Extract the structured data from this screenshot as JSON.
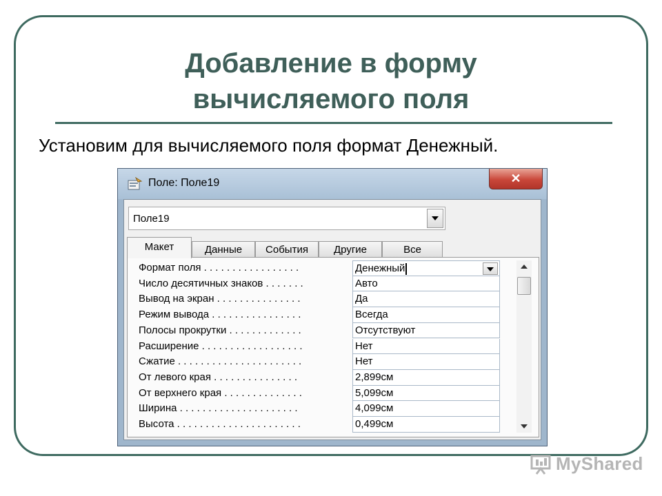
{
  "slide": {
    "title_line1": "Добавление в форму",
    "title_line2": "вычисляемого поля",
    "subtitle": "Установим для вычисляемого поля формат Денежный."
  },
  "dialog": {
    "title": "Поле: Поле19",
    "close_glyph": "✕",
    "object_combo": {
      "value": "Поле19"
    },
    "tabs": [
      {
        "label": "Макет",
        "active": true
      },
      {
        "label": "Данные",
        "active": false
      },
      {
        "label": "События",
        "active": false
      },
      {
        "label": "Другие",
        "active": false
      },
      {
        "label": "Все",
        "active": false
      }
    ],
    "properties": [
      {
        "label": "Формат поля . . . . . . . . . . . . . . . . .",
        "value": "Денежный"
      },
      {
        "label": "Число десятичных знаков . . . . . . .",
        "value": "Авто"
      },
      {
        "label": "Вывод на экран . . . . . . . . . . . . . . .",
        "value": "Да"
      },
      {
        "label": "Режим вывода . . . . . . . . . . . . . . . .",
        "value": "Всегда"
      },
      {
        "label": "Полосы прокрутки . . . . . . . . . . . . .",
        "value": "Отсутствуют"
      },
      {
        "label": "Расширение . . . . . . . . . . . . . . . . . .",
        "value": "Нет"
      },
      {
        "label": "Сжатие . . . . . . . . . . . . . . . . . . . . . .",
        "value": "Нет"
      },
      {
        "label": "От левого края . . . . . . . . . . . . . . .",
        "value": "2,899см"
      },
      {
        "label": "От верхнего края . . . . . . . . . . . . . .",
        "value": "5,099см"
      },
      {
        "label": "Ширина . . . . . . . . . . . . . . . . . . . . .",
        "value": "4,099см"
      },
      {
        "label": "Высота . . . . . . . . . . . . . . . . . . . . . .",
        "value": "0,499см"
      }
    ]
  },
  "watermark": {
    "text": "MyShared"
  },
  "icons": {
    "app": "form-properties-icon",
    "combo": "chevron-down-icon",
    "scroll_up": "arrow-up-icon",
    "scroll_down": "arrow-down-icon",
    "watermark": "presentation-board-icon"
  },
  "colors": {
    "title": "#3f5f59",
    "frame": "#3e6a60",
    "dialog_chrome": "#9fb6cc",
    "close_button": "#c9473a"
  }
}
